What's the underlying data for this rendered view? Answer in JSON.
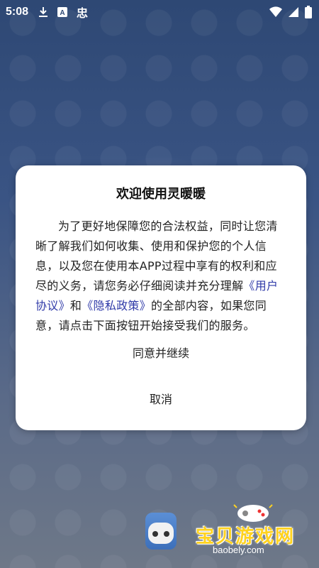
{
  "status_bar": {
    "time": "5:08",
    "icons_left": [
      "download-icon",
      "keyboard-a-icon",
      "app-notification-icon"
    ],
    "icons_right": [
      "wifi-icon",
      "signal-icon",
      "battery-icon"
    ],
    "keyboard_glyph": "A",
    "notification_glyph": "忠"
  },
  "dialog": {
    "title": "欢迎使用灵暖暖",
    "body_part1": "为了更好地保障您的合法权益，同时让您清晰了解我们如何收集、使用和保护您的个人信息，以及您在使用本APP过程中享有的权利和应尽的义务，请您务必仔细阅读并充分理解",
    "user_agreement_link": "《用户协议》",
    "body_and": "和",
    "privacy_policy_link": "《隐私政策》",
    "body_part2": "的全部内容，如果您同意，请点击下面按钮开始接受我们的服务。",
    "agree_button": "同意并继续",
    "cancel_button": "取消"
  },
  "watermark": {
    "text": "宝贝游戏网",
    "url": "baobely.com"
  }
}
